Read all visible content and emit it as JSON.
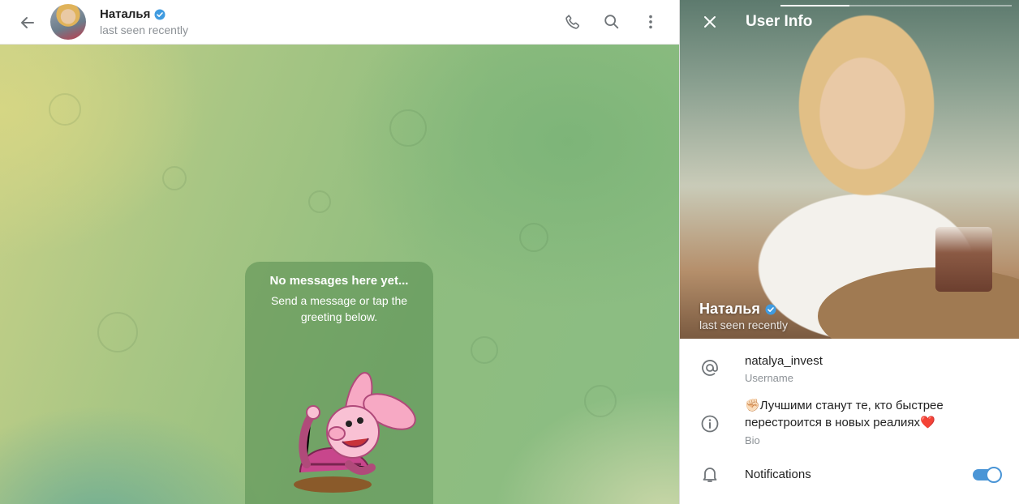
{
  "chat": {
    "name": "Наталья",
    "status": "last seen recently",
    "icons": {
      "back": "arrow-left-icon",
      "call": "phone-icon",
      "search": "search-icon",
      "more": "more-vertical-icon",
      "verified": "verified-badge-icon"
    },
    "empty": {
      "title": "No messages here yet...",
      "subtitle": "Send a message or tap the greeting below."
    }
  },
  "info": {
    "title": "User Info",
    "name": "Наталья",
    "status": "last seen recently",
    "username": "natalya_invest",
    "username_label": "Username",
    "bio": "✊🏻Лучшими станут те, кто быстрее перестроится в новых реалиях❤️",
    "bio_label": "Bio",
    "notifications_label": "Notifications",
    "notifications_on": true,
    "icons": {
      "close": "close-icon",
      "username": "at-sign-icon",
      "bio": "info-icon",
      "notifications": "bell-icon"
    }
  },
  "colors": {
    "accent": "#4a95d6",
    "verified": "#3f9be0"
  }
}
